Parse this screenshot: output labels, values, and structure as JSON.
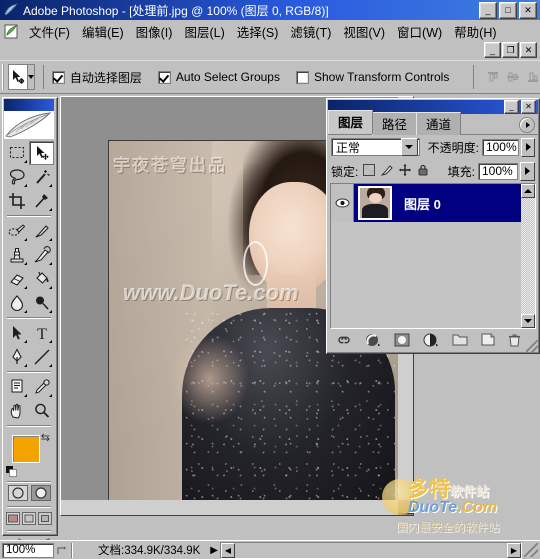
{
  "window": {
    "title": "Adobe Photoshop - [处理前.jpg @ 100% (图层 0, RGB/8)]",
    "app_icon": "photoshop-icon",
    "minimize": "_",
    "maximize": "□",
    "close": "✕",
    "child_minimize": "_",
    "child_restore": "❐",
    "child_close": "✕"
  },
  "menubar": {
    "doc_icon": "document-icon",
    "items": [
      {
        "label": "文件(F)"
      },
      {
        "label": "编辑(E)"
      },
      {
        "label": "图像(I)"
      },
      {
        "label": "图层(L)"
      },
      {
        "label": "选择(S)"
      },
      {
        "label": "滤镜(T)"
      },
      {
        "label": "视图(V)"
      },
      {
        "label": "窗口(W)"
      },
      {
        "label": "帮助(H)"
      }
    ]
  },
  "options_bar": {
    "tool_icon": "move-tool-icon",
    "tool_preset_dropdown": "chevron-down-icon",
    "auto_select_layer": {
      "label": "自动选择图层",
      "checked": true
    },
    "auto_select_groups": {
      "label": "Auto Select Groups",
      "checked": true
    },
    "show_transform_controls": {
      "label": "Show Transform Controls",
      "checked": false
    },
    "align_icons": [
      "align-top-edges-icon",
      "align-vertical-centers-icon",
      "align-bottom-edges-icon"
    ]
  },
  "toolbox": {
    "banner_icon": "feather-logo-icon",
    "tools": [
      [
        {
          "name": "marquee-tool-icon",
          "selected": false
        },
        {
          "name": "move-tool-icon",
          "selected": true
        }
      ],
      [
        {
          "name": "lasso-tool-icon",
          "selected": false
        },
        {
          "name": "magic-wand-tool-icon",
          "selected": false
        }
      ],
      [
        {
          "name": "crop-tool-icon",
          "selected": false
        },
        {
          "name": "slice-tool-icon",
          "selected": false
        }
      ],
      [
        {
          "name": "healing-brush-tool-icon",
          "selected": false
        },
        {
          "name": "brush-tool-icon",
          "selected": false
        }
      ],
      [
        {
          "name": "clone-stamp-tool-icon",
          "selected": false
        },
        {
          "name": "history-brush-tool-icon",
          "selected": false
        }
      ],
      [
        {
          "name": "eraser-tool-icon",
          "selected": false
        },
        {
          "name": "paint-bucket-tool-icon",
          "selected": false
        }
      ],
      [
        {
          "name": "blur-tool-icon",
          "selected": false
        },
        {
          "name": "dodge-tool-icon",
          "selected": false
        }
      ],
      [
        {
          "name": "path-selection-tool-icon",
          "selected": false
        },
        {
          "name": "type-tool-icon",
          "selected": false
        }
      ],
      [
        {
          "name": "pen-tool-icon",
          "selected": false
        },
        {
          "name": "line-tool-icon",
          "selected": false
        }
      ],
      [
        {
          "name": "notes-tool-icon",
          "selected": false
        },
        {
          "name": "eyedropper-tool-icon",
          "selected": false
        }
      ],
      [
        {
          "name": "hand-tool-icon",
          "selected": false
        },
        {
          "name": "zoom-tool-icon",
          "selected": false
        }
      ]
    ],
    "foreground_color": "#f5a300",
    "background_color": "#ffffff",
    "swap_colors_icon": "swap-colors-icon",
    "default_colors_icon": "default-colors-icon",
    "quick_mask": [
      "standard-mode-icon",
      "quick-mask-mode-icon"
    ],
    "screen_modes": [
      "standard-screen-mode-icon",
      "full-screen-with-menubar-icon",
      "full-screen-mode-icon"
    ],
    "jump_to": [
      "jump-to-imageready-icon",
      "imageready-icon"
    ]
  },
  "document": {
    "canvas_watermark_cn": "宇夜苍穹出品",
    "canvas_watermark_url": "www.DuoTe.com"
  },
  "layers_palette": {
    "close_icon": "✕",
    "minimize_icon": "_",
    "tabs": [
      {
        "label": "图层",
        "active": true
      },
      {
        "label": "路径",
        "active": false
      },
      {
        "label": "通道",
        "active": false
      }
    ],
    "menu_icon": "palette-menu-icon",
    "blend_mode": "正常",
    "blend_mode_arrow": "chevron-down-icon",
    "opacity_label": "不透明度:",
    "opacity_value": "100%",
    "opacity_arrow": "chevron-right-icon",
    "lock_label": "锁定:",
    "lock_icons": [
      "lock-transparent-pixels-icon",
      "lock-image-pixels-icon",
      "lock-position-icon",
      "lock-all-icon"
    ],
    "fill_label": "填充:",
    "fill_value": "100%",
    "fill_arrow": "chevron-right-icon",
    "layers": [
      {
        "name": "图层 0",
        "visible": true,
        "eye_icon": "eye-icon",
        "thumbnail": "layer-thumbnail",
        "selected": true
      }
    ],
    "scroll_up_icon": "scroll-up-arrow-icon",
    "scroll_down_icon": "scroll-down-arrow-icon",
    "footer_buttons": [
      "link-layers-icon",
      "layer-style-icon",
      "layer-mask-icon",
      "new-adjustment-layer-icon",
      "new-group-icon",
      "new-layer-icon",
      "delete-layer-icon"
    ]
  },
  "status_bar": {
    "zoom_value": "100%",
    "grip_icon": "size-grip-icon",
    "doc_info": "文档:334.9K/334.9K",
    "info_arrow": "▶",
    "scroll_left_icon": "◀",
    "scroll_right_icon": "▶",
    "resize_icon": "resize-grip-icon"
  },
  "logo_watermark": {
    "brand_cn": "多特",
    "brand_cn_small": "软件站",
    "brand_en_blue": "DuoTe",
    "brand_en_orange": ".Com",
    "tagline": "国内最安全的软件站"
  }
}
